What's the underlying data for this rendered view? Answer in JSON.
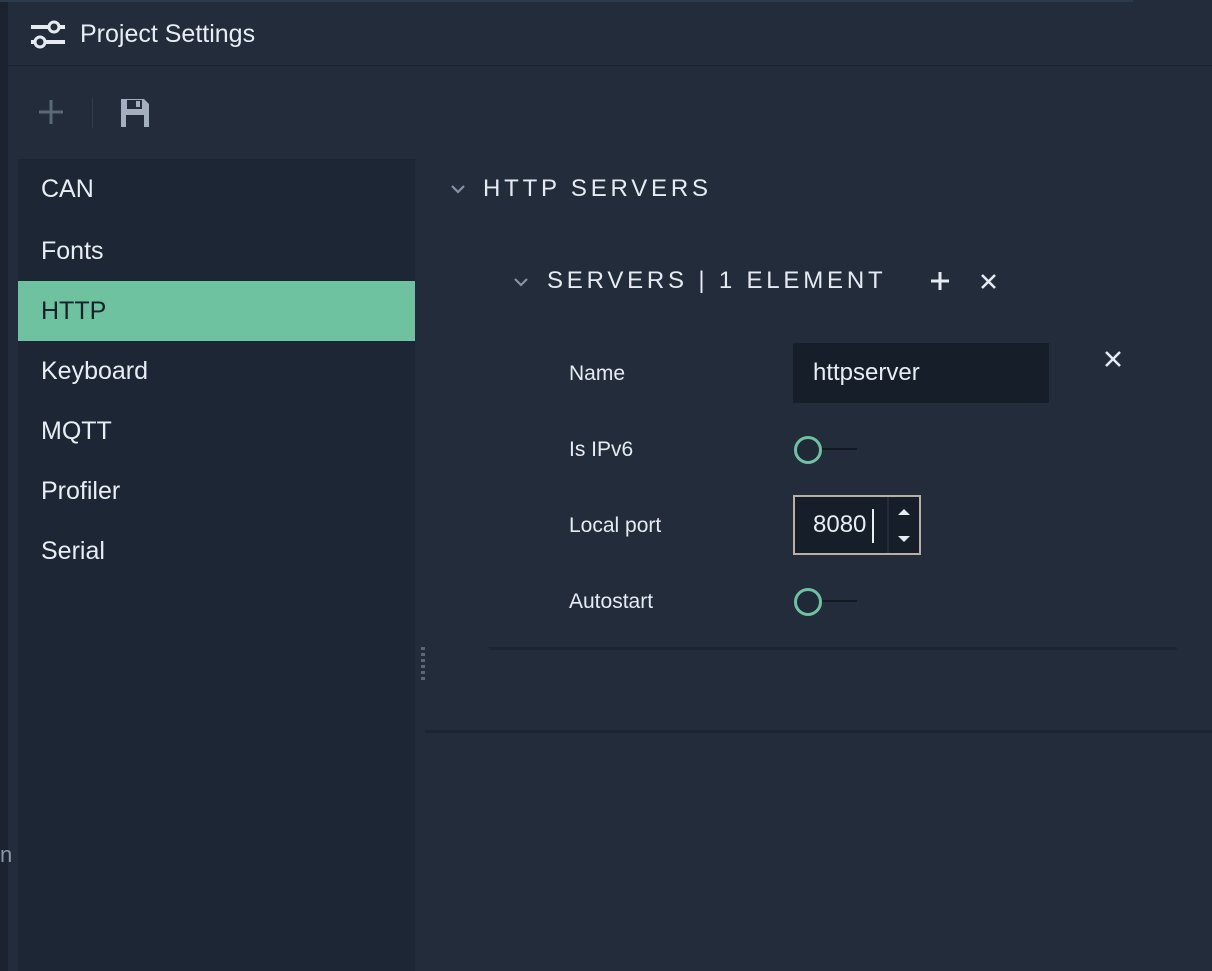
{
  "window": {
    "title": "Project Settings",
    "title_icon": "sliders-icon"
  },
  "toolbar": {
    "add_icon": "plus-icon",
    "save_icon": "save-icon"
  },
  "sidebar": {
    "items": [
      {
        "label": "CAN",
        "active": false
      },
      {
        "label": "Fonts",
        "active": false
      },
      {
        "label": "HTTP",
        "active": true
      },
      {
        "label": "Keyboard",
        "active": false
      },
      {
        "label": "MQTT",
        "active": false
      },
      {
        "label": "Profiler",
        "active": false
      },
      {
        "label": "Serial",
        "active": false
      }
    ]
  },
  "main": {
    "section_title": "HTTP SERVERS",
    "subsection": {
      "title": "SERVERS | 1 ELEMENT",
      "fields": {
        "name": {
          "label": "Name",
          "value": "httpserver"
        },
        "is_ipv6": {
          "label": "Is IPv6",
          "checked": false
        },
        "local_port": {
          "label": "Local port",
          "value": "8080"
        },
        "autostart": {
          "label": "Autostart",
          "checked": false
        }
      }
    }
  },
  "background": {
    "fragment_text": "n"
  },
  "colors": {
    "accent": "#6fc2a0",
    "background": "#222c3b",
    "sidebar": "#1c2634",
    "input_background": "#161e29",
    "text": "#e6ebf2"
  }
}
